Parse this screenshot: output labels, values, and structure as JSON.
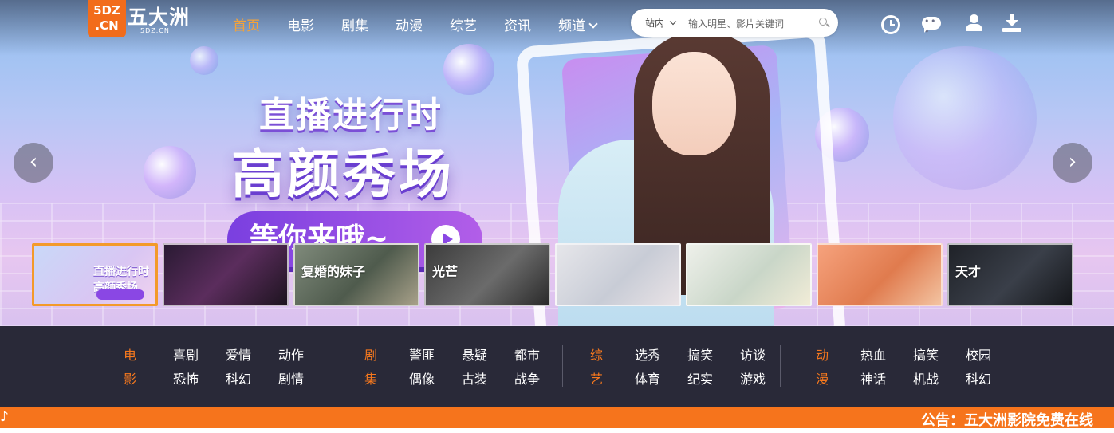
{
  "logo": {
    "badge_top": "5DZ",
    "badge_bottom": ".CN",
    "name": "五大洲",
    "sub": "5DZ.CN"
  },
  "nav": {
    "items": [
      {
        "label": "首页",
        "active": true
      },
      {
        "label": "电影"
      },
      {
        "label": "剧集"
      },
      {
        "label": "动漫"
      },
      {
        "label": "综艺"
      },
      {
        "label": "资讯"
      },
      {
        "label": "频道"
      }
    ]
  },
  "search": {
    "scope": "站内",
    "placeholder": "输入明星、影片关键词"
  },
  "header_icons": [
    "clock-icon",
    "chat-icon",
    "user-icon",
    "download-icon"
  ],
  "hero": {
    "line1": "直播进行时",
    "line2": "高颜秀场",
    "cta": "等你来哦~",
    "prev_symbol": "‹",
    "next_symbol": "›"
  },
  "thumbnails": [
    {
      "text": "直播进行时 高颜秀场",
      "active": true
    },
    {
      "text": ""
    },
    {
      "text": "复婚的妹子"
    },
    {
      "text": "光芒"
    },
    {
      "text": ""
    },
    {
      "text": ""
    },
    {
      "text": ""
    },
    {
      "text": "天才"
    }
  ],
  "categories": [
    {
      "title": [
        "电",
        "影"
      ],
      "links": [
        "喜剧",
        "爱情",
        "动作",
        "恐怖",
        "科幻",
        "剧情"
      ]
    },
    {
      "title": [
        "剧",
        "集"
      ],
      "links": [
        "警匪",
        "悬疑",
        "都市",
        "偶像",
        "古装",
        "战争"
      ]
    },
    {
      "title": [
        "综",
        "艺"
      ],
      "links": [
        "选秀",
        "搞笑",
        "访谈",
        "体育",
        "纪实",
        "游戏"
      ]
    },
    {
      "title": [
        "动",
        "漫"
      ],
      "links": [
        "热血",
        "搞笑",
        "校园",
        "神话",
        "机战",
        "科幻"
      ]
    }
  ],
  "notice": {
    "text": "公告：五大洲影院免费在线"
  },
  "colors": {
    "accent": "#f6741c",
    "active_nav": "#f2a23a",
    "catbar_bg": "#292938"
  }
}
